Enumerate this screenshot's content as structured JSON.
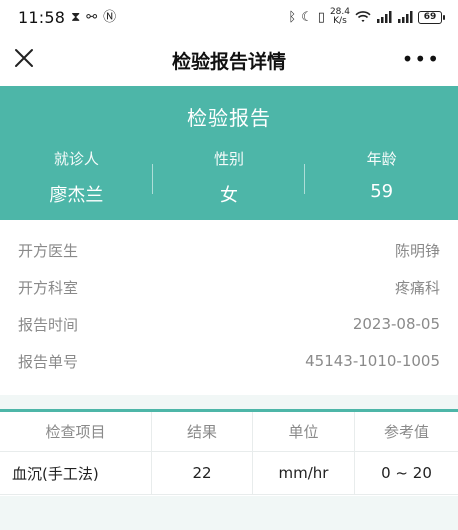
{
  "status": {
    "time": "11:58",
    "speed_top": "28.4",
    "speed_bottom": "K/s",
    "battery": "69"
  },
  "nav": {
    "title": "检验报告详情",
    "more": "•••"
  },
  "header": {
    "title": "检验报告",
    "columns": [
      {
        "label": "就诊人",
        "value": "廖杰兰"
      },
      {
        "label": "性别",
        "value": "女"
      },
      {
        "label": "年龄",
        "value": "59"
      }
    ]
  },
  "info": [
    {
      "label": "开方医生",
      "value": "陈明铮"
    },
    {
      "label": "开方科室",
      "value": "疼痛科"
    },
    {
      "label": "报告时间",
      "value": "2023-08-05"
    },
    {
      "label": "报告单号",
      "value": "45143-1010-1005"
    }
  ],
  "table": {
    "headers": [
      "检查项目",
      "结果",
      "单位",
      "参考值"
    ],
    "rows": [
      [
        "血沉(手工法)",
        "22",
        "mm/hr",
        "0 ~ 20"
      ]
    ]
  },
  "colors": {
    "accent": "#4db6a8"
  },
  "icons": [
    "close-icon",
    "more-icon",
    "hourglass-icon",
    "bluetooth-icon",
    "moon-icon",
    "vibrate-icon",
    "wifi-icon",
    "signal-icon",
    "battery-icon"
  ]
}
